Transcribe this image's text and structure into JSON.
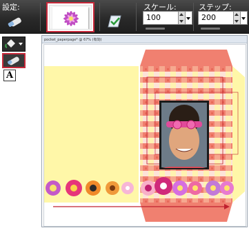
{
  "toolbar": {
    "settings_label": "設定:",
    "scale_label": "スケール:",
    "scale_value": "100",
    "step_label": "ステップ:",
    "step_value": "200"
  },
  "document": {
    "title": "pocket_paperpage* @ 67% (有効)"
  },
  "colors": {
    "accent_red": "#c8283a",
    "envelope_yellow": "#fff7a8",
    "envelope_pink": "#f08070"
  },
  "tools": [
    {
      "icon": "paint-bucket-icon"
    },
    {
      "icon": "eraser-icon"
    },
    {
      "icon": "text-tool-icon",
      "glyph": "A"
    }
  ]
}
